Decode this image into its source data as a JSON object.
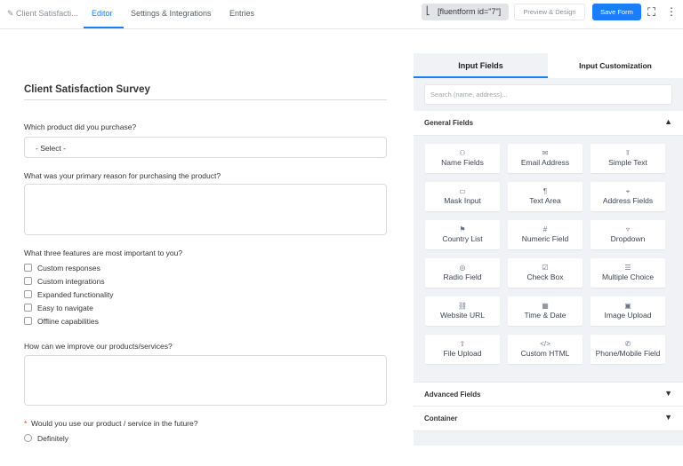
{
  "topbar": {
    "form_name": "Client Satisfacti...",
    "tabs": [
      "Editor",
      "Settings & Integrations",
      "Entries"
    ],
    "shortcode": "[fluentform id=\"7\"]",
    "preview_label": "Preview & Design",
    "save_label": "Save Form"
  },
  "form": {
    "title": "Client Satisfaction Survey",
    "q1": "Which product did you purchase?",
    "q1_select": "- Select -",
    "q2": "What was your primary reason for purchasing the product?",
    "q3": "What three features are most important to you?",
    "q3_options": [
      "Custom responses",
      "Custom integrations",
      "Expanded functionality",
      "Easy to navigate",
      "Offline capabilities"
    ],
    "q4": "How can we improve our products/services?",
    "q5_required": "*",
    "q5": "Would you use our product / service in the future?",
    "q5_option": "Definitely"
  },
  "panel": {
    "tabs": [
      "Input Fields",
      "Input Customization"
    ],
    "search_placeholder": "Search (name, address)...",
    "general_label": "General Fields",
    "fields": [
      {
        "label": "Name Fields",
        "icon": "user-icon",
        "glyph": "⚇"
      },
      {
        "label": "Email Address",
        "icon": "envelope-icon",
        "glyph": "✉"
      },
      {
        "label": "Simple Text",
        "icon": "text-icon",
        "glyph": "⫪"
      },
      {
        "label": "Mask Input",
        "icon": "keyboard-icon",
        "glyph": "▭"
      },
      {
        "label": "Text Area",
        "icon": "paragraph-icon",
        "glyph": "¶"
      },
      {
        "label": "Address Fields",
        "icon": "location-pin-icon",
        "glyph": "⌖"
      },
      {
        "label": "Country List",
        "icon": "flag-icon",
        "glyph": "⚑"
      },
      {
        "label": "Numeric Field",
        "icon": "hash-icon",
        "glyph": "#"
      },
      {
        "label": "Dropdown",
        "icon": "dropdown-icon",
        "glyph": "▿"
      },
      {
        "label": "Radio Field",
        "icon": "radio-icon",
        "glyph": "◎"
      },
      {
        "label": "Check Box",
        "icon": "checkbox-icon",
        "glyph": "☑"
      },
      {
        "label": "Multiple Choice",
        "icon": "list-icon",
        "glyph": "☰"
      },
      {
        "label": "Website URL",
        "icon": "link-icon",
        "glyph": "⛓"
      },
      {
        "label": "Time & Date",
        "icon": "calendar-icon",
        "glyph": "▦"
      },
      {
        "label": "Image Upload",
        "icon": "image-icon",
        "glyph": "▣"
      },
      {
        "label": "File Upload",
        "icon": "upload-icon",
        "glyph": "⇧"
      },
      {
        "label": "Custom HTML",
        "icon": "code-icon",
        "glyph": "</>"
      },
      {
        "label": "Phone/Mobile Field",
        "icon": "phone-icon",
        "glyph": "✆"
      }
    ],
    "advanced_label": "Advanced Fields",
    "container_label": "Container"
  },
  "colors": {
    "accent": "#1a7efb"
  }
}
